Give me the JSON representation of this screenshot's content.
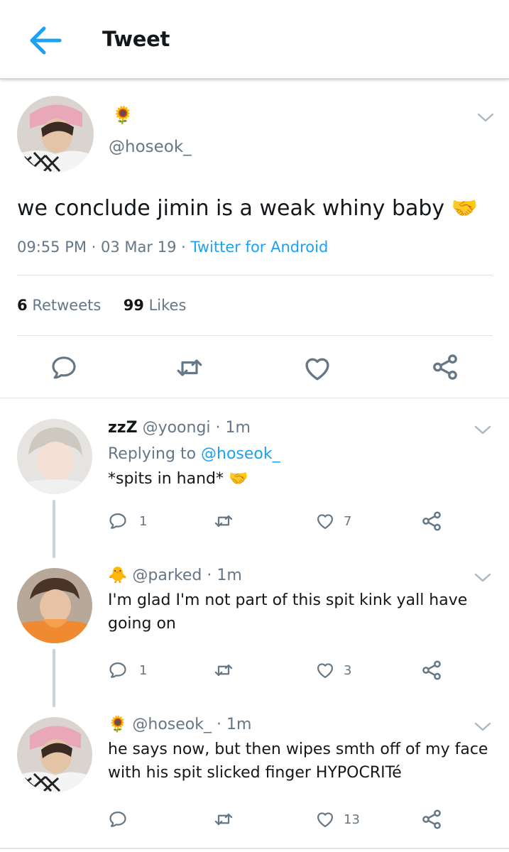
{
  "header": {
    "title": "Tweet"
  },
  "main_tweet": {
    "emoji_name": "🌻",
    "handle": "@hoseok_",
    "text": "we conclude jimin is a weak whiny baby 🤝",
    "time": "09:55 PM",
    "date": "03 Mar 19",
    "source": "Twitter for Android",
    "retweets_count": "6",
    "retweets_label": "Retweets",
    "likes_count": "99",
    "likes_label": "Likes"
  },
  "replies": [
    {
      "name": "zzZ",
      "handle": "@yoongi",
      "time": "1m",
      "replying_prefix": "Replying to",
      "replying_handle": "@hoseok_",
      "text": "*spits in hand* 🤝",
      "reply_count": "1",
      "retweet_count": "",
      "like_count": "7"
    },
    {
      "name": "🐥",
      "handle": "@parked",
      "time": "1m",
      "text": "I'm glad I'm not part of this spit kink yall have going on",
      "reply_count": "1",
      "retweet_count": "",
      "like_count": "3"
    },
    {
      "name": "🌻",
      "handle": "@hoseok_",
      "time": "1m",
      "text": "he says now, but then wipes smth off of my face with his spit slicked finger HYPOCRITé",
      "reply_count": "",
      "retweet_count": "",
      "like_count": "13"
    }
  ],
  "colors": {
    "accent": "#1da1f2",
    "secondary_text": "#657786",
    "icon": "#657786",
    "divider": "#dde3e8"
  }
}
